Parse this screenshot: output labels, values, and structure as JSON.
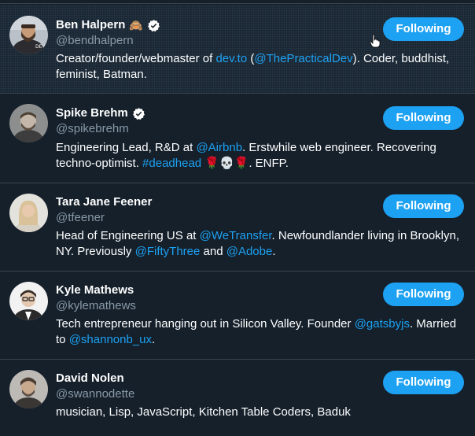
{
  "users": [
    {
      "name": "Ben Halpern",
      "handle": "@bendhalpern",
      "name_emoji": "🙈",
      "verified": true,
      "follow_label": "Following",
      "bio": [
        {
          "text": "Creator/founder/webmaster of "
        },
        {
          "text": "dev.to",
          "link": true
        },
        {
          "text": " ("
        },
        {
          "text": "@ThePracticalDev",
          "link": true
        },
        {
          "text": "). Coder, buddhist, feminist, Batman."
        }
      ]
    },
    {
      "name": "Spike Brehm",
      "handle": "@spikebrehm",
      "verified": true,
      "follow_label": "Following",
      "bio": [
        {
          "text": "Engineering Lead, R&D at "
        },
        {
          "text": "@Airbnb",
          "link": true
        },
        {
          "text": ". Erstwhile web engineer. Recovering techno-optimist. "
        },
        {
          "text": "#deadhead",
          "link": true
        },
        {
          "text": " 🌹💀🌹. ENFP."
        }
      ]
    },
    {
      "name": "Tara Jane Feener",
      "handle": "@tfeener",
      "verified": false,
      "follow_label": "Following",
      "bio": [
        {
          "text": "Head of Engineering US at "
        },
        {
          "text": "@WeTransfer",
          "link": true
        },
        {
          "text": ". Newfoundlander living in Brooklyn, NY. Previously "
        },
        {
          "text": "@FiftyThree",
          "link": true
        },
        {
          "text": " and "
        },
        {
          "text": "@Adobe",
          "link": true
        },
        {
          "text": "."
        }
      ]
    },
    {
      "name": "Kyle Mathews",
      "handle": "@kylemathews",
      "verified": false,
      "follow_label": "Following",
      "bio": [
        {
          "text": "Tech entrepreneur hanging out in Silicon Valley. Founder "
        },
        {
          "text": "@gatsbyjs",
          "link": true
        },
        {
          "text": ". Married to "
        },
        {
          "text": "@shannonb_ux",
          "link": true
        },
        {
          "text": "."
        }
      ]
    },
    {
      "name": "David Nolen",
      "handle": "@swannodette",
      "verified": false,
      "follow_label": "Following",
      "bio": [
        {
          "text": "musician, Lisp, JavaScript, Kitchen Table Coders, Baduk"
        }
      ]
    }
  ],
  "colors": {
    "background": "#15202b",
    "hover_background": "#192734",
    "accent": "#1da1f2",
    "muted_text": "#8899a6",
    "divider": "#38444d"
  }
}
